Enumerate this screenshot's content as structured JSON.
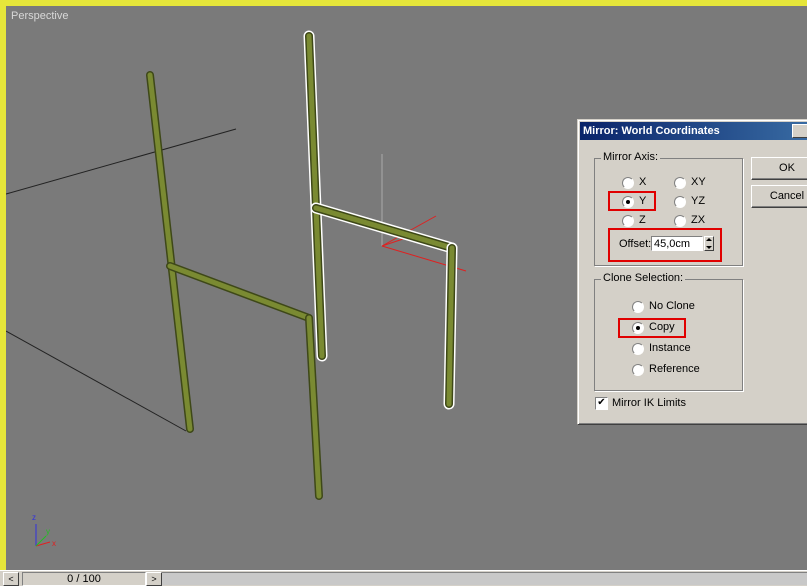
{
  "viewport": {
    "label": "Perspective"
  },
  "axis_gizmo": {
    "x": "x",
    "y": "y",
    "z": "z"
  },
  "timeline": {
    "frame_display": "0 / 100",
    "prev_icon": "<",
    "next_icon": ">"
  },
  "dialog": {
    "title": "Mirror: World Coordinates",
    "ok_label": "OK",
    "cancel_label": "Cancel",
    "mirror_axis": {
      "label": "Mirror Axis:",
      "options": [
        "X",
        "Y",
        "Z",
        "XY",
        "YZ",
        "ZX"
      ],
      "selected": "Y"
    },
    "offset": {
      "label": "Offset:",
      "value": "45,0cm"
    },
    "clone_selection": {
      "label": "Clone Selection:",
      "options": [
        "No Clone",
        "Copy",
        "Instance",
        "Reference"
      ],
      "selected": "Copy"
    },
    "mirror_ik": {
      "label": "Mirror IK Limits",
      "checked": true
    }
  },
  "colors": {
    "viewport_border": "#e6e63a",
    "viewport_bg": "#7a7a7a",
    "pipe": "#6b7a2a",
    "highlight": "#e00000"
  }
}
